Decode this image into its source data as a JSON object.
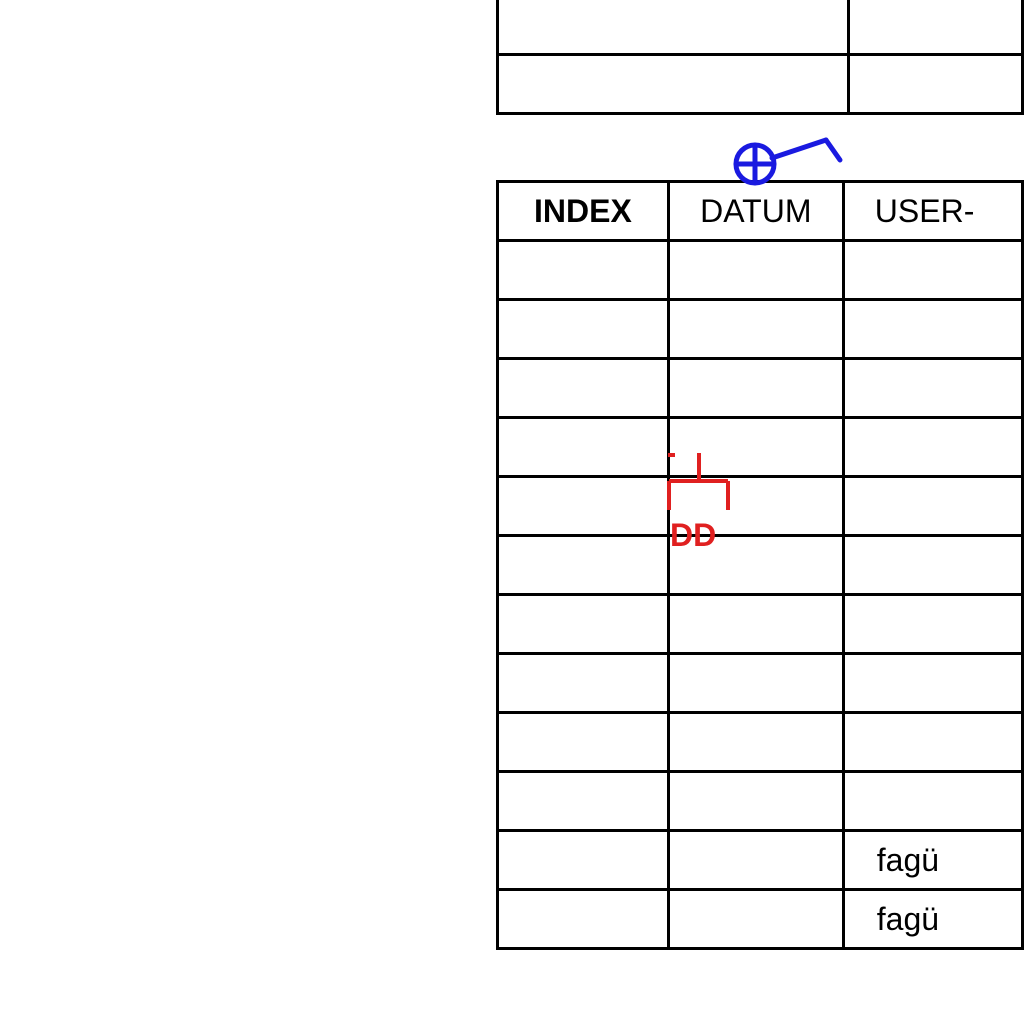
{
  "table": {
    "headers": [
      "INDEX",
      "DATUM",
      "USER-"
    ],
    "rows": [
      [
        "",
        "",
        ""
      ],
      [
        "",
        "",
        ""
      ],
      [
        "",
        "",
        ""
      ],
      [
        "",
        "",
        ""
      ],
      [
        "",
        "",
        ""
      ],
      [
        "",
        "",
        ""
      ],
      [
        "",
        "",
        ""
      ],
      [
        "",
        "",
        ""
      ],
      [
        "",
        "",
        ""
      ],
      [
        "",
        "",
        ""
      ],
      [
        "",
        "",
        "fagü"
      ],
      [
        "",
        "",
        "fagü"
      ]
    ]
  },
  "annotations": {
    "red_label": "DD",
    "red_color": "#e02020",
    "blue_color": "#1a1ae0"
  }
}
